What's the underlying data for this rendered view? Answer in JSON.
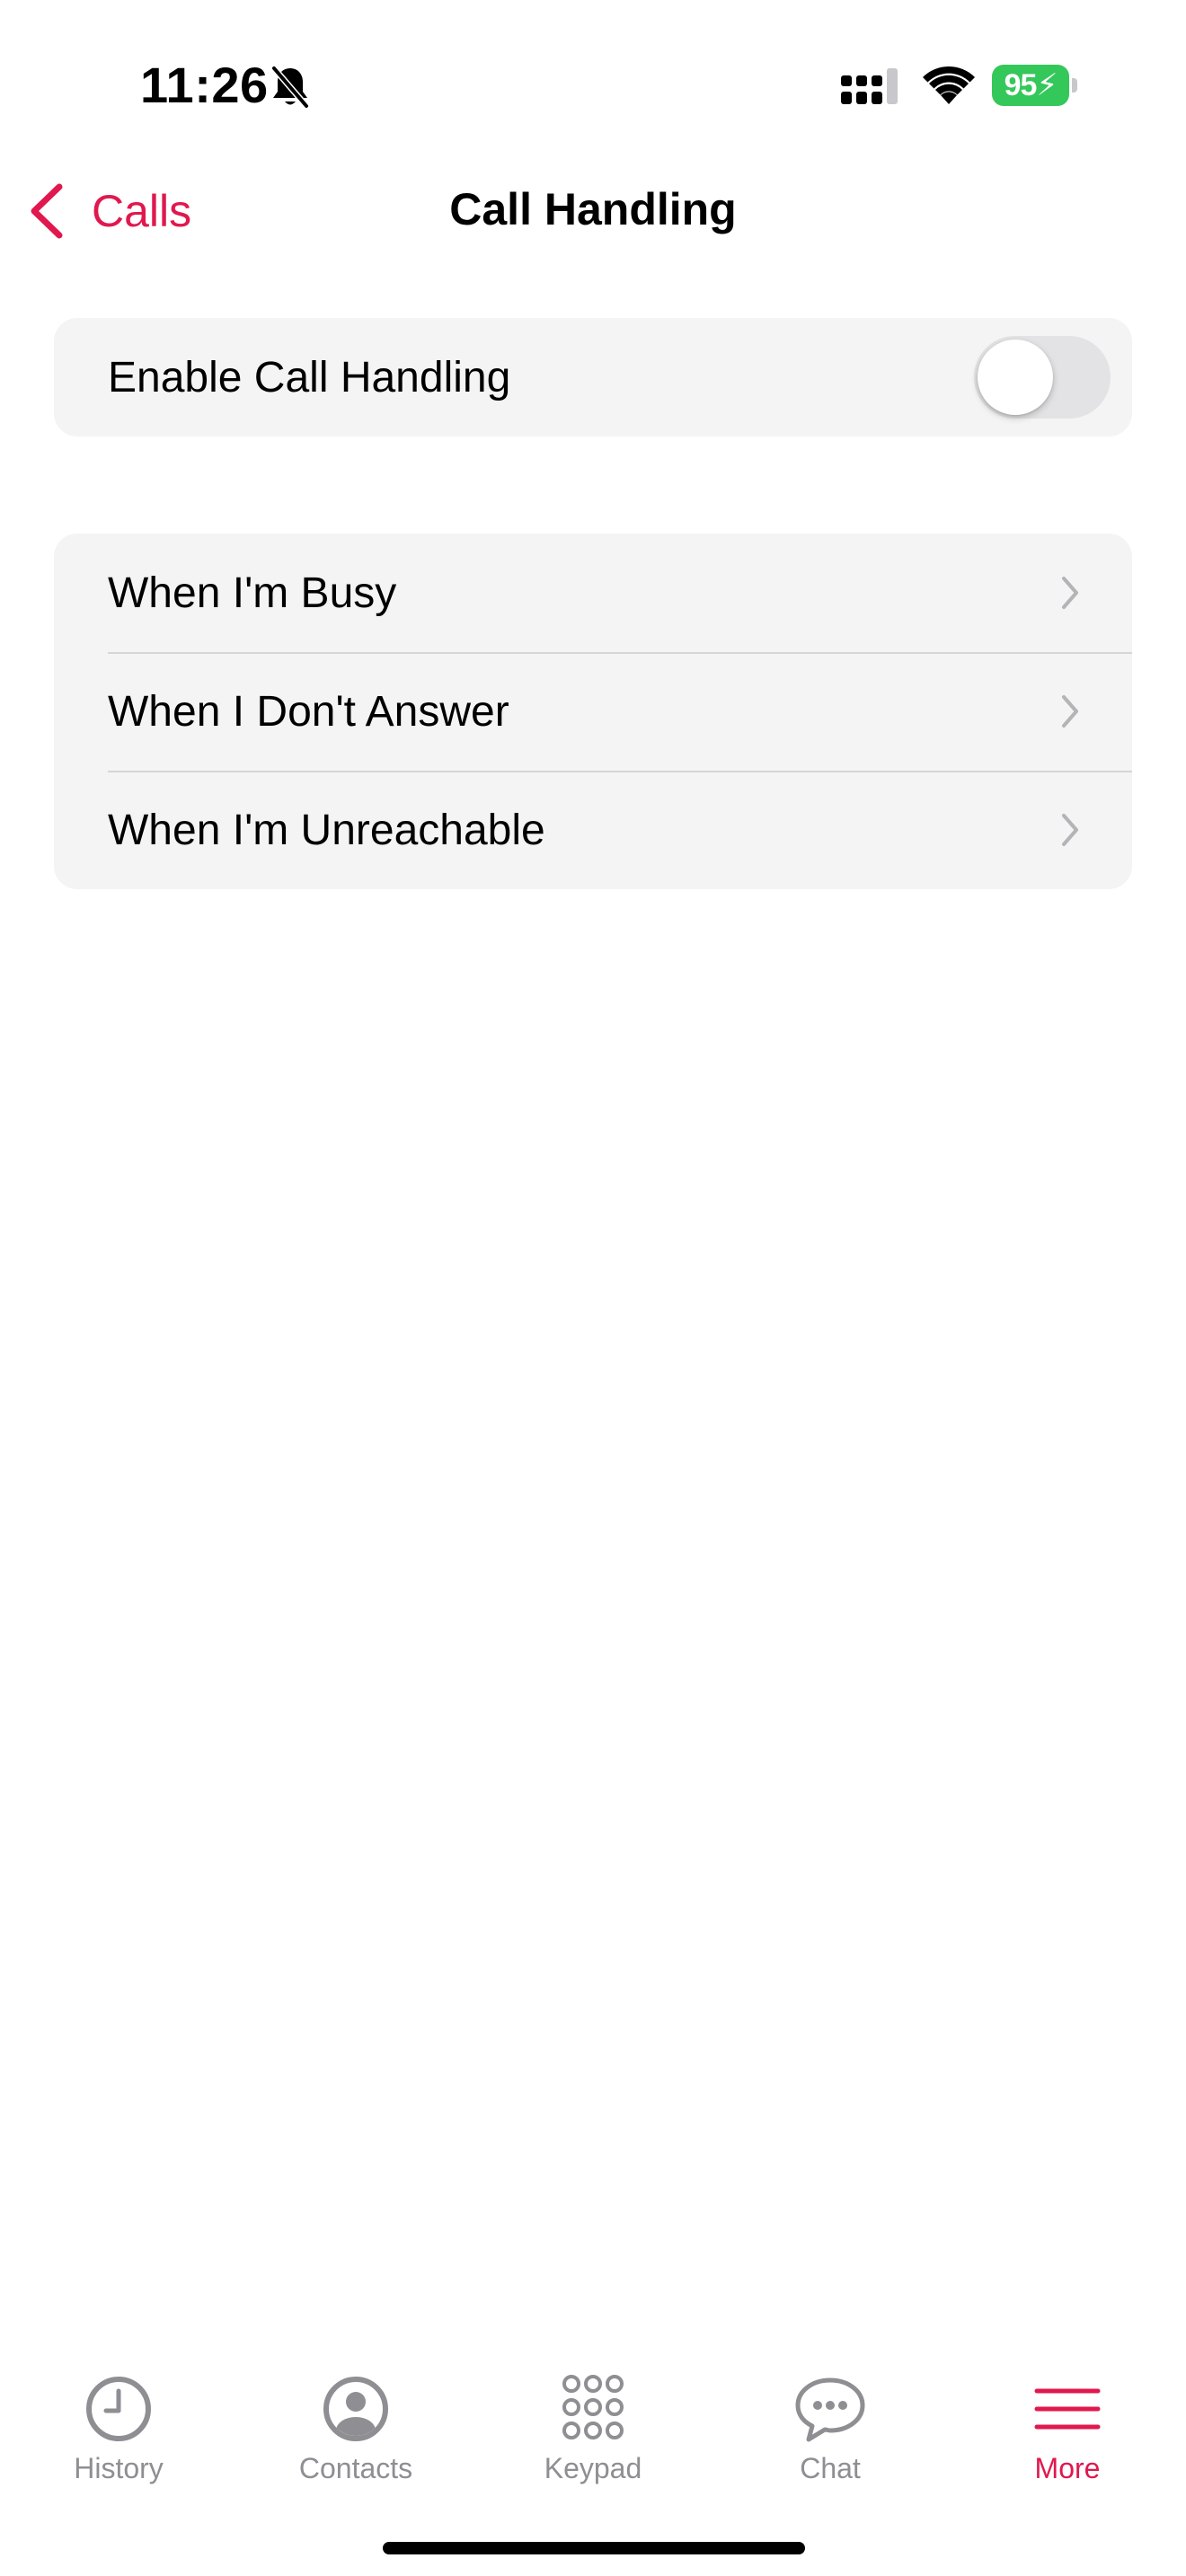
{
  "status_bar": {
    "time": "11:26",
    "battery_percent": "95",
    "icons": [
      "bell-slash-icon",
      "cellular-signal-icon",
      "wifi-icon",
      "battery-charging-icon"
    ]
  },
  "nav": {
    "back_label": "Calls",
    "title": "Call Handling"
  },
  "settings": {
    "enable_label": "Enable Call Handling",
    "enable_value": false,
    "rules": [
      {
        "label": "When I'm Busy"
      },
      {
        "label": "When I Don't Answer"
      },
      {
        "label": "When I'm Unreachable"
      }
    ]
  },
  "tab_bar": {
    "tabs": [
      {
        "label": "History",
        "icon": "clock-icon",
        "active": false
      },
      {
        "label": "Contacts",
        "icon": "person-circle-icon",
        "active": false
      },
      {
        "label": "Keypad",
        "icon": "keypad-icon",
        "active": false
      },
      {
        "label": "Chat",
        "icon": "chat-bubble-icon",
        "active": false
      },
      {
        "label": "More",
        "icon": "menu-lines-icon",
        "active": true
      }
    ]
  },
  "colors": {
    "accent": "#e0184e",
    "inactive_tab": "#8e8e93",
    "group_background": "#f4f4f4",
    "battery": "#34c759"
  }
}
